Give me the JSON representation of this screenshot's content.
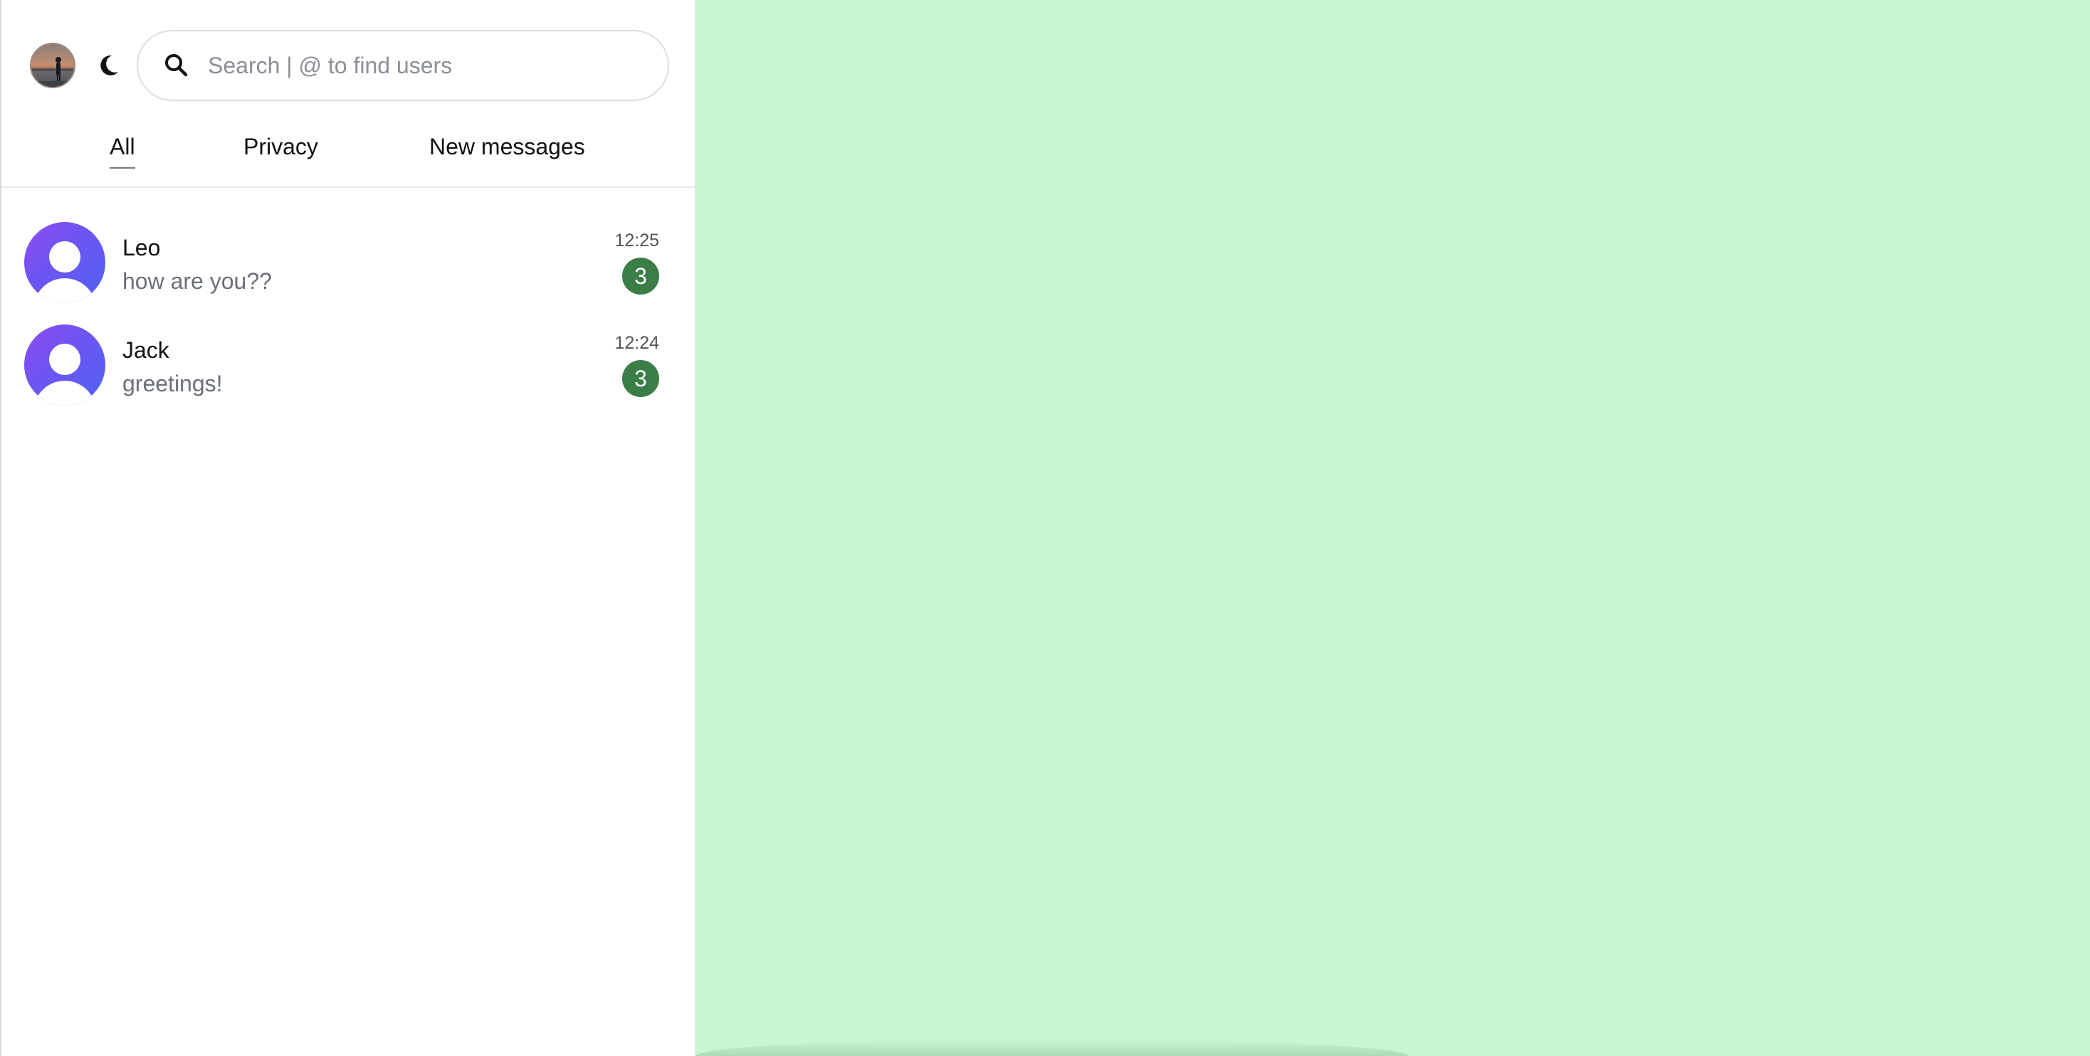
{
  "header": {
    "search": {
      "placeholder": "Search | @ to find users",
      "value": ""
    },
    "icons": {
      "search": "search-icon",
      "theme": "moon-icon"
    }
  },
  "tabs": [
    {
      "label": "All",
      "active": true
    },
    {
      "label": "Privacy",
      "active": false
    },
    {
      "label": "New messages",
      "active": false
    }
  ],
  "chats": [
    {
      "name": "Leo",
      "preview": "how are you??",
      "time": "12:25",
      "unread": "3"
    },
    {
      "name": "Jack",
      "preview": "greetings!",
      "time": "12:24",
      "unread": "3"
    }
  ],
  "colors": {
    "main_background": "#c8f5d3",
    "sidebar_background": "#ffffff",
    "badge": "#3b7d46",
    "avatar_gradient_start": "#8d4cf0",
    "avatar_gradient_end": "#4f63f5"
  }
}
